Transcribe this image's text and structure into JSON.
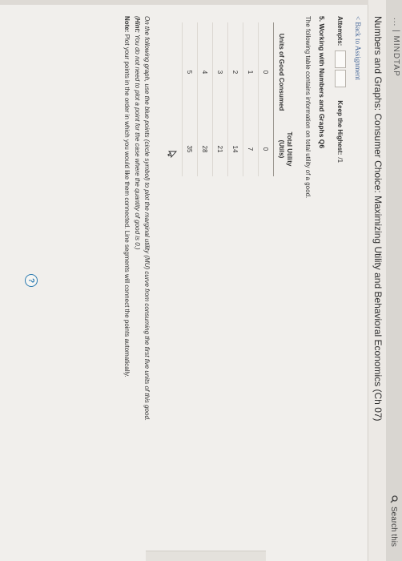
{
  "window": {
    "truncated_title": "... | MINDTAP",
    "search_label": "Search this",
    "page_title": "Numbers and Graphs: Consumer Choice: Maximizing Utility and Behavioral Economics (Ch 07)"
  },
  "nav": {
    "back_link": "< Back to Assignment"
  },
  "attempts": {
    "label": "Attempts:",
    "keep_label": "Keep the Highest:",
    "keep_value": "/1"
  },
  "question": {
    "title": "5. Working with Numbers and Graphs Q6",
    "intro": "The following table contains information on total utility of a good."
  },
  "table": {
    "col1_header": "Units of Good Consumed",
    "col2_header_line1": "Total Utility",
    "col2_header_line2": "(Utils)",
    "rows": [
      {
        "units": "0",
        "utility": "0"
      },
      {
        "units": "1",
        "utility": "7"
      },
      {
        "units": "2",
        "utility": "14"
      },
      {
        "units": "3",
        "utility": "21"
      },
      {
        "units": "4",
        "utility": "28"
      },
      {
        "units": "5",
        "utility": "35"
      }
    ]
  },
  "instructions": {
    "line1": "On the following graph, use the blue points (circle symbol) to plot the marginal utility (MU) curve from consuming the first five units of this good.",
    "hint_label": "Hint:",
    "hint_text": "You do not need to plot a point for the case where the quantity of good is 0.)",
    "hint_open": "(",
    "note_label": "Note:",
    "note_text": "Plot your points in the order in which you would like them connected. Line segments will connect the points automatically."
  },
  "help": {
    "label": "?"
  },
  "icons": {
    "search": "search-icon",
    "help": "help-icon",
    "cursor": "cursor-arrow-icon"
  },
  "colors": {
    "link": "#4a6a9a",
    "help_accent": "#2a7ab0"
  }
}
